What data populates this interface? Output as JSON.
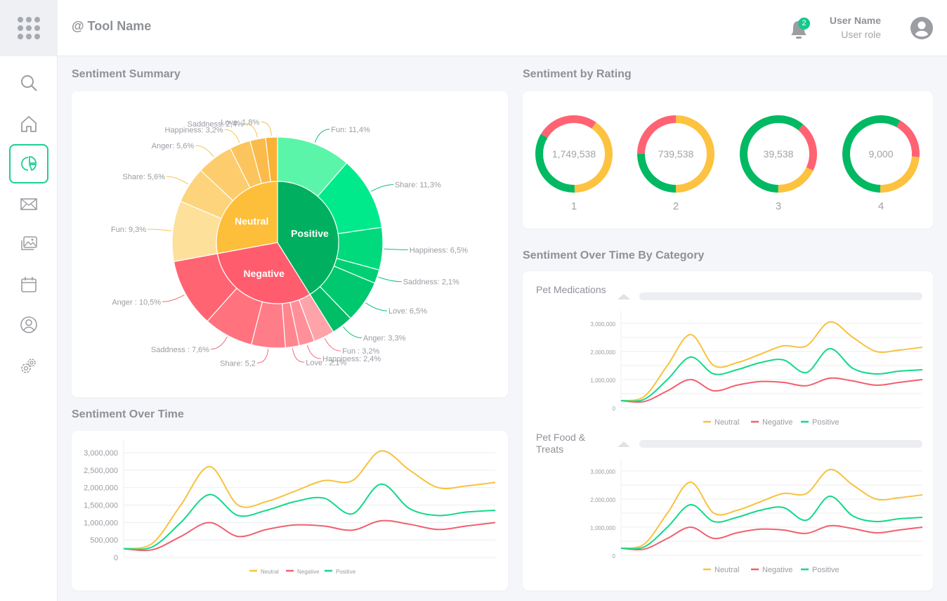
{
  "header": {
    "tool_name": "@ Tool Name",
    "notifications": "2",
    "user_name": "User Name",
    "user_role": "User role"
  },
  "sidebar": {
    "items": [
      {
        "icon": "search-icon"
      },
      {
        "icon": "home-icon"
      },
      {
        "icon": "chart-pie-icon",
        "active": true
      },
      {
        "icon": "mail-icon"
      },
      {
        "icon": "images-icon"
      },
      {
        "icon": "calendar-icon"
      },
      {
        "icon": "user-icon"
      },
      {
        "icon": "settings-icon"
      }
    ]
  },
  "colors": {
    "accent": "#1ecf8f",
    "positive": "#00b060",
    "negative": "#ff5d6e",
    "neutral": "#fdbe3a",
    "line_positive": "#12d98a",
    "line_negative": "#f2606e",
    "line_neutral": "#f7c23e"
  },
  "sections": {
    "summary": "Sentiment Summary",
    "rating": "Sentiment by Rating",
    "over_time": "Sentiment Over Time",
    "by_category": "Sentiment Over Time By Category"
  },
  "chart_data": [
    {
      "type": "sunburst",
      "groups": [
        {
          "name": "Positive",
          "children": [
            {
              "label": "Fun: 11,4%",
              "value": 11.4
            },
            {
              "label": "Share: 11,3%",
              "value": 11.3
            },
            {
              "label": "Happiness: 6,5%",
              "value": 6.5
            },
            {
              "label": "Saddness: 2,1%",
              "value": 2.1
            },
            {
              "label": "Love: 6,5%",
              "value": 6.5
            },
            {
              "label": "Anger: 3,3%",
              "value": 3.3
            }
          ]
        },
        {
          "name": "Negative",
          "children": [
            {
              "label": "Fun : 3,2%",
              "value": 3.2
            },
            {
              "label": "Happiness: 2,4%",
              "value": 2.4
            },
            {
              "label": "Love : 2,1%",
              "value": 2.1
            },
            {
              "label": "Share: 5,2",
              "value": 5.2
            },
            {
              "label": "Saddness : 7,6%",
              "value": 7.6
            },
            {
              "label": "Anger : 10,5%",
              "value": 10.5
            }
          ]
        },
        {
          "name": "Neutral",
          "children": [
            {
              "label": "Fun: 9,3%",
              "value": 9.3
            },
            {
              "label": "Share: 5,6%",
              "value": 5.6
            },
            {
              "label": "Anger: 5,6%",
              "value": 5.6
            },
            {
              "label": "Happiness: 3,2%",
              "value": 3.2
            },
            {
              "label": "Saddness: 2,4%",
              "value": 2.4
            },
            {
              "label": "Love: 1,8%",
              "value": 1.8
            }
          ]
        }
      ]
    },
    {
      "type": "donut",
      "items": [
        {
          "label": "1",
          "total": "1,749,538",
          "shares": {
            "neutral": 0.4,
            "positive": 0.34,
            "negative": 0.26
          }
        },
        {
          "label": "2",
          "total": "739,538",
          "shares": {
            "neutral": 0.5,
            "positive": 0.25,
            "negative": 0.25
          }
        },
        {
          "label": "3",
          "total": "39,538",
          "shares": {
            "negative": 0.21,
            "neutral": 0.18,
            "positive": 0.61
          }
        },
        {
          "label": "4",
          "total": "9,000",
          "shares": {
            "negative": 0.18,
            "neutral": 0.24,
            "positive": 0.58
          }
        }
      ]
    },
    {
      "type": "line",
      "title": "",
      "ylim": [
        0,
        3000000
      ],
      "yticks": [
        "0",
        "500,000",
        "1,000,000",
        "1,500,000",
        "2,000,000",
        "2,500,000",
        "3,000,000"
      ],
      "legend": "bottom",
      "series": [
        {
          "name": "Neutral",
          "values": [
            250000,
            400000,
            1500000,
            2600000,
            1500000,
            1600000,
            1900000,
            2200000,
            2200000,
            3050000,
            2500000,
            2000000,
            2050000,
            2150000
          ]
        },
        {
          "name": "Negative",
          "values": [
            250000,
            220000,
            600000,
            1000000,
            600000,
            800000,
            930000,
            900000,
            780000,
            1050000,
            950000,
            800000,
            900000,
            1000000
          ]
        },
        {
          "name": "Positive",
          "values": [
            250000,
            300000,
            1000000,
            1800000,
            1200000,
            1350000,
            1600000,
            1700000,
            1250000,
            2100000,
            1400000,
            1200000,
            1300000,
            1350000
          ]
        }
      ]
    },
    {
      "type": "line",
      "title": "Pet Medications",
      "ylim": [
        0,
        3000000
      ],
      "yticks": [
        "0",
        "1,000,000",
        "2,000,000",
        "3,000,000"
      ],
      "legend": "bottom",
      "series": [
        {
          "name": "Neutral",
          "values": [
            250000,
            400000,
            1500000,
            2600000,
            1500000,
            1600000,
            1900000,
            2200000,
            2200000,
            3050000,
            2500000,
            2000000,
            2050000,
            2150000
          ]
        },
        {
          "name": "Negative",
          "values": [
            250000,
            220000,
            600000,
            1000000,
            600000,
            800000,
            930000,
            900000,
            780000,
            1050000,
            950000,
            800000,
            900000,
            1000000
          ]
        },
        {
          "name": "Positive",
          "values": [
            250000,
            300000,
            1000000,
            1800000,
            1200000,
            1350000,
            1600000,
            1700000,
            1250000,
            2100000,
            1400000,
            1200000,
            1300000,
            1350000
          ]
        }
      ]
    },
    {
      "type": "line",
      "title": "Pet Food & Treats",
      "ylim": [
        0,
        3000000
      ],
      "yticks": [
        "0",
        "1,000,000",
        "2,000,000",
        "3,000,000"
      ],
      "legend": "bottom",
      "series": [
        {
          "name": "Neutral",
          "values": [
            250000,
            400000,
            1500000,
            2600000,
            1500000,
            1600000,
            1900000,
            2200000,
            2200000,
            3050000,
            2500000,
            2000000,
            2050000,
            2150000
          ]
        },
        {
          "name": "Negative",
          "values": [
            250000,
            220000,
            600000,
            1000000,
            600000,
            800000,
            930000,
            900000,
            780000,
            1050000,
            950000,
            800000,
            900000,
            1000000
          ]
        },
        {
          "name": "Positive",
          "values": [
            250000,
            300000,
            1000000,
            1800000,
            1200000,
            1350000,
            1600000,
            1700000,
            1250000,
            2100000,
            1400000,
            1200000,
            1300000,
            1350000
          ]
        }
      ]
    }
  ]
}
